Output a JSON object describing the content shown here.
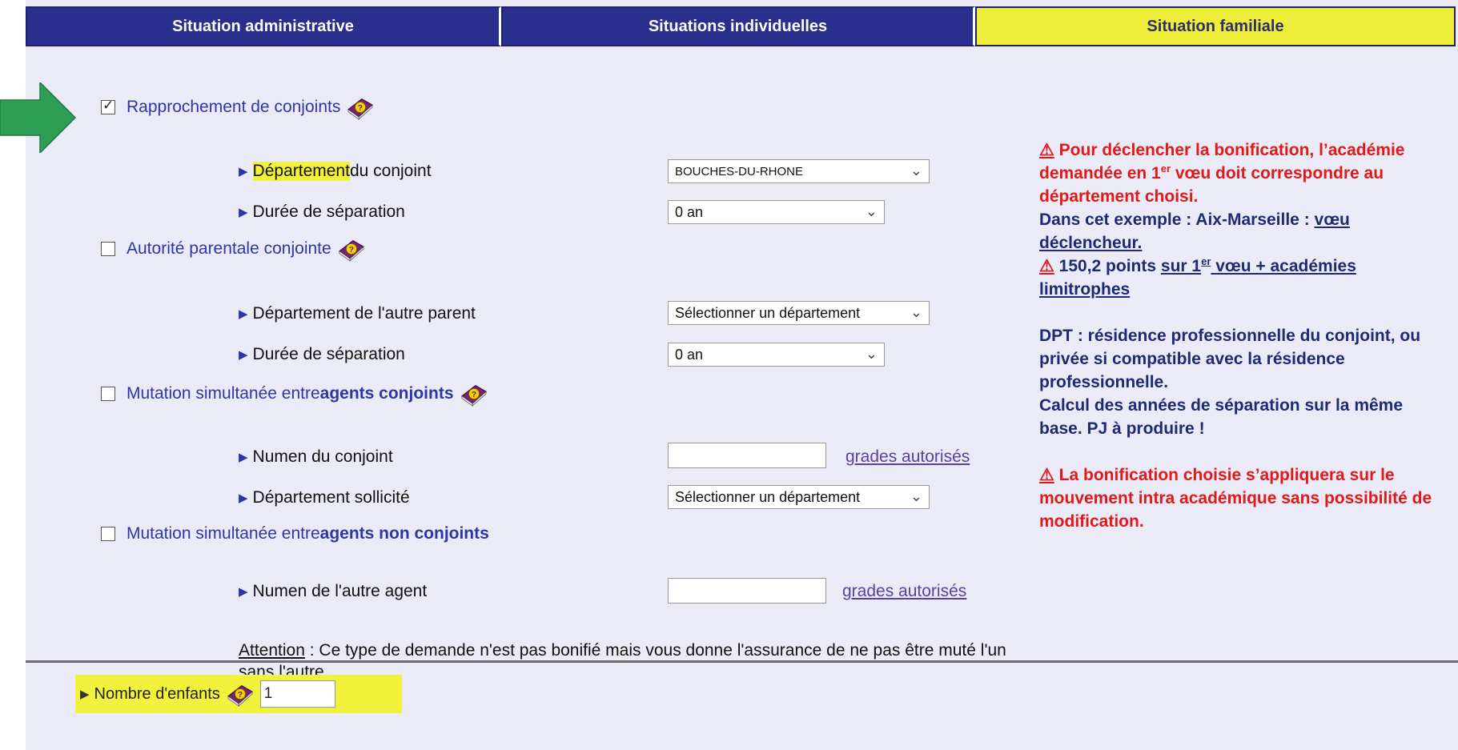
{
  "tabs": [
    {
      "label": "Situation administrative",
      "active": false
    },
    {
      "label": "Situations individuelles",
      "active": false
    },
    {
      "label": "Situation familiale",
      "active": true
    }
  ],
  "rapprochement": {
    "checked": true,
    "label": "Rapprochement de conjoints",
    "dept_label_hl": "Département",
    "dept_label_rest": " du conjoint",
    "dept_value": "BOUCHES-DU-RHONE",
    "duree_label": "Durée de séparation",
    "duree_value": "0 an"
  },
  "autorite": {
    "checked": false,
    "label": "Autorité parentale conjointe",
    "dept_label": "Département de l'autre parent",
    "dept_value": "Sélectionner un département",
    "duree_label": "Durée de séparation",
    "duree_value": "0 an"
  },
  "mutation_conjoints": {
    "checked": false,
    "label_prefix": "Mutation simultanée entre ",
    "label_bold": "agents conjoints",
    "numen_label": "Numen du conjoint",
    "numen_value": "",
    "grades_link": "grades autorisés",
    "dept_label": "Département sollicité",
    "dept_value": "Sélectionner un département"
  },
  "mutation_non_conjoints": {
    "checked": false,
    "label_prefix": "Mutation simultanée entre ",
    "label_bold": "agents non conjoints",
    "numen_label": "Numen de l'autre agent",
    "numen_value": "",
    "grades_link": "grades autorisés"
  },
  "attention": {
    "word": "Attention",
    "text": " : Ce type de demande n'est pas bonifié mais vous donne l'assurance de ne pas être muté l'un sans l'autre."
  },
  "enfants": {
    "label": "Nombre d'enfants",
    "value": "1"
  },
  "notes": {
    "n1": "Pour déclencher la bonification, l’académie  demandée en 1",
    "n1_sup": "er",
    "n1_end": " vœu doit correspondre au département choisi.",
    "n2": "Dans cet exemple : Aix-Marseille : ",
    "n2_u": "vœu déclencheur.",
    "n3": "150,2 points ",
    "n3_u": "sur 1",
    "n3_sup": "er",
    "n3_u2": " vœu + académies limitrophes",
    "n4": "DPT : résidence professionnelle du conjoint, ou privée si compatible avec la résidence professionnelle.",
    "n5": "Calcul des années de séparation sur la même base. PJ à produire !",
    "n6": "La bonification choisie s’appliquera sur le mouvement intra académique sans possibilité de modification."
  },
  "colors": {
    "tab_bg": "#2a2e8c",
    "tab_active_bg": "#eeee3a",
    "panel_bg": "#ebebf7",
    "highlight": "#f2f23c",
    "warning_red": "#e01919",
    "note_navy": "#1d2a74",
    "arrow_green": "#2e9e55"
  },
  "icons": [
    "help-book-icon",
    "green-arrow-icon",
    "warning-icon",
    "triangle-bullet-icon"
  ]
}
